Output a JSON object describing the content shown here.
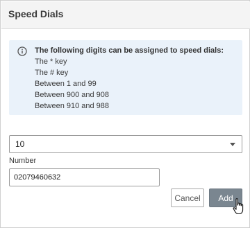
{
  "dialog": {
    "title": "Speed Dials"
  },
  "info": {
    "icon": "info-icon",
    "lines": [
      "The following digits can be assigned to speed dials:",
      "The * key",
      "The # key",
      "Between 1 and 99",
      "Between 900 and 908",
      "Between 910 and 988"
    ]
  },
  "speed_dial_select": {
    "selected": "10"
  },
  "number_field": {
    "label": "Number",
    "value": "02079460632"
  },
  "buttons": {
    "cancel_label": "Cancel",
    "add_label": "Add"
  },
  "colors": {
    "header_bg": "#f4f4f4",
    "info_bg": "#eaf2fa",
    "add_button_bg": "#7a8690"
  }
}
